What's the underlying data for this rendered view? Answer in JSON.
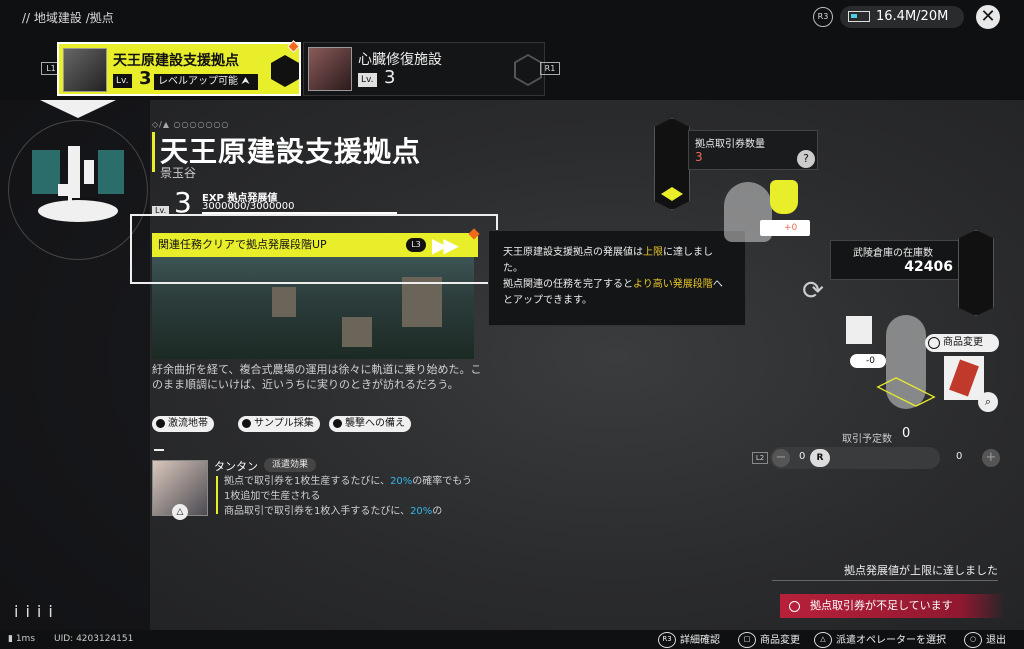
{
  "header": {
    "breadcrumb": "// 地域建設 /拠点",
    "r3": "R3",
    "storage": "16.4M/20M",
    "close_label": "✕"
  },
  "tabs": {
    "l1": "L1",
    "r1": "R1",
    "cards": [
      {
        "name": "天王原建設支援拠点",
        "lv_label": "Lv.",
        "lv": "3",
        "status": "レベルアップ可能"
      },
      {
        "name": "心臓修復施設",
        "lv_label": "Lv.",
        "lv": "3"
      }
    ]
  },
  "base": {
    "dots": "◇/▲ ○○○○○○○",
    "title": "天王原建設支援拠点",
    "subtitle": "景玉谷",
    "lv_label": "Lv.",
    "level": "3",
    "exp_label": "拠点発展値",
    "exp_value": "3000000/3000000",
    "exp_fill": 1.0,
    "quest": "関連任務クリアで拠点発展段階UP",
    "quest_key": "L3",
    "description": "紆余曲折を経て、複合式農場の運用は徐々に軌道に乗り始めた。このまま順調にいけば、近いうちに実りのときが訪れるだろう。",
    "tags": [
      "激流地帯",
      "サンプル採集",
      "襲撃への備え"
    ]
  },
  "tooltip": {
    "line1_a": "天王原建設支援拠点の発展値は",
    "line1_hl": "上限",
    "line1_b": "に達しました。",
    "line2_a": "拠点関連の任務を完了すると",
    "line2_hl": "より高い発展段階",
    "line2_b": "へとアップできます。"
  },
  "operator": {
    "name": "タンタン",
    "badge": "派遣効果",
    "text1_a": "拠点で取引券を1枚生産するたびに、",
    "text1_pct": "20%",
    "text1_b": "の確率でもう1枚追加で生産される",
    "text2_a": "商品取引で取引券を1枚入手するたびに、",
    "text2_pct": "20%",
    "text2_b": "の",
    "badge_key": "△"
  },
  "trade": {
    "ticket_label": "拠点取引券数量",
    "ticket_count": "3",
    "help": "?",
    "ticket_delta": "+0",
    "stock_label": "武陵倉庫の在庫数",
    "stock_count": "42406",
    "cube_delta": "-0",
    "change_label": "商品変更",
    "trade_label": "取引予定数",
    "trade_value": "0",
    "l2": "L2",
    "slider_left": "0",
    "slider_right": "0",
    "knob": "R",
    "max_msg": "拠点発展値が上限に達しました",
    "warning": "拠点取引券が不足しています"
  },
  "footer": {
    "ping": "1ms",
    "uid": "UID: 4203124151",
    "hints": [
      {
        "key": "R3",
        "label": "詳細確認"
      },
      {
        "key": "□",
        "label": "商品変更"
      },
      {
        "key": "△",
        "label": "派遣オペレーターを選択"
      },
      {
        "key": "○",
        "label": "退出"
      }
    ]
  },
  "colors": {
    "accent": "#e9ee2a",
    "alert": "#b8203a",
    "highlight": "#e9c52a",
    "percent": "#35b4e8"
  }
}
